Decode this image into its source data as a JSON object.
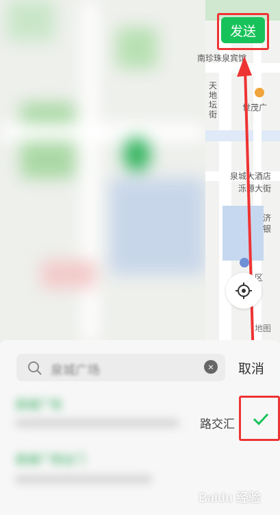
{
  "map": {
    "labels": {
      "hotel_top": "南珍珠泉宾馆",
      "street": "天地坛街",
      "mall": "世茂广",
      "hotel_mid": "泉城大酒店",
      "building": "泺源大街",
      "bank": "济银",
      "community": "小区",
      "map_credit": "地图"
    }
  },
  "header": {
    "send_label": "发送"
  },
  "search": {
    "query": "泉城广场",
    "cancel_label": "取消"
  },
  "results": [
    {
      "name": "泉城广场",
      "address": "路交汇",
      "selected": true
    },
    {
      "name": "泉城广场北门",
      "address": "",
      "selected": false
    }
  ],
  "watermark": "Baidu 经验",
  "colors": {
    "accent": "#18c25a",
    "annotation": "#e33333"
  }
}
